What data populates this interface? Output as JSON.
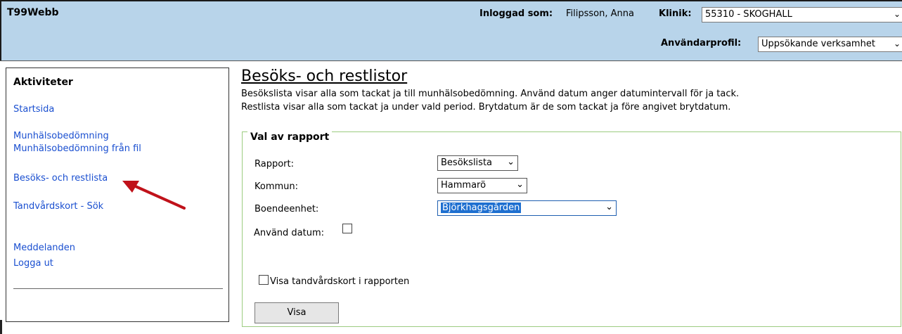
{
  "header": {
    "app_title": "T99Webb",
    "logged_in_label": "Inloggad som:",
    "logged_in_user": "Filipsson, Anna",
    "clinic_label": "Klinik:",
    "clinic_value": "55310 - SKOGHALL",
    "profile_label": "Användarprofil:",
    "profile_value": "Uppsökande verksamhet"
  },
  "sidebar": {
    "title": "Aktiviteter",
    "items": [
      {
        "label": "Startsida"
      },
      {
        "label": "Munhälsobedömning"
      },
      {
        "label": "Munhälsobedömning från fil"
      },
      {
        "label": "Besöks- och restlista"
      },
      {
        "label": "Tandvårdskort - Sök"
      },
      {
        "label": "Meddelanden"
      },
      {
        "label": "Logga ut"
      }
    ]
  },
  "main": {
    "title": "Besöks- och restlistor",
    "desc_line1": "Besökslista visar alla som tackat ja till munhälsobedömning. Använd datum anger datumintervall för ja tack.",
    "desc_line2": "Restlista visar alla som tackat ja under vald period. Brytdatum är de som tackat ja före angivet brytdatum.",
    "section_title": "Val av rapport",
    "rapport_label": "Rapport:",
    "rapport_value": "Besökslista",
    "kommun_label": "Kommun:",
    "kommun_value": "Hammarö",
    "boende_label": "Boendeenhet:",
    "boende_value": "Björkhagsgården",
    "use_date_label": "Använd datum:",
    "show_card_label": "Visa tandvårdskort i rapporten",
    "show_button": "Visa"
  },
  "colors": {
    "header_bg": "#b8d4ea",
    "link": "#1a4fd0",
    "fieldset_border": "#9ccc80",
    "selection": "#1e6fd0",
    "arrow": "#c0121a"
  }
}
